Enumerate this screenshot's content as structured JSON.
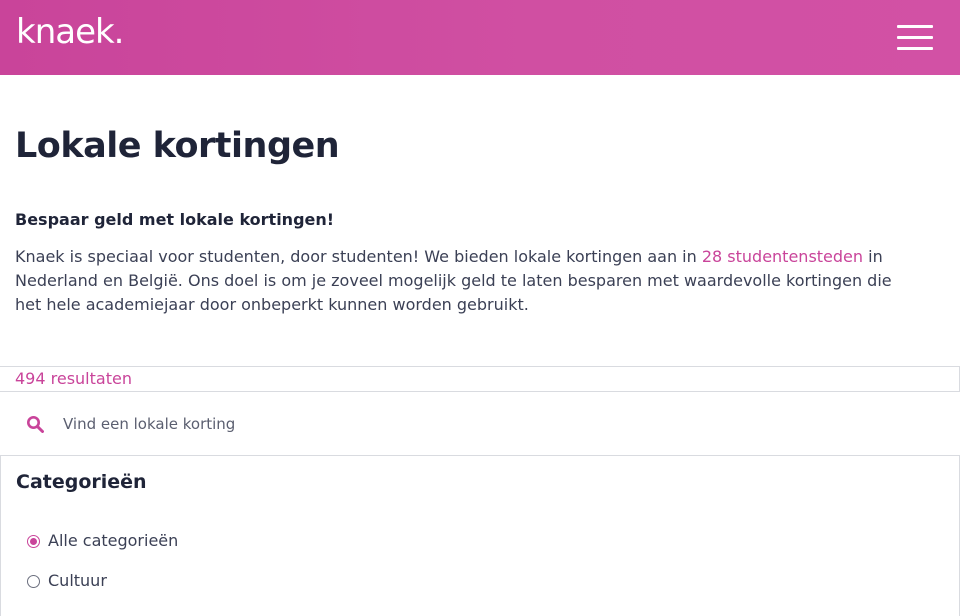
{
  "header": {
    "logo": "knaek.",
    "menu_icon": "hamburger-menu-icon"
  },
  "main": {
    "title": "Lokale kortingen",
    "subtitle": "Bespaar geld met lokale kortingen!",
    "intro_before_link": "Knaek is speciaal voor studenten, door studenten! We bieden lokale kortingen aan in ",
    "intro_link": "28 studentensteden",
    "intro_after_link": " in Nederland en België. Ons doel is om je zoveel mogelijk geld te laten besparen met waardevolle kortingen die het hele academiejaar door onbeperkt kunnen worden gebruikt."
  },
  "results": {
    "count_label": "494 resultaten"
  },
  "search": {
    "icon": "search-icon",
    "placeholder": "Vind een lokale korting",
    "value": ""
  },
  "categories": {
    "title": "Categorieën",
    "options": [
      {
        "label": "Alle categorieën",
        "selected": true
      },
      {
        "label": "Cultuur",
        "selected": false
      }
    ]
  },
  "colors": {
    "brand": "#c9449a",
    "text_dark": "#1f2438",
    "text_body": "#3b4055",
    "border": "#d9dbe0"
  }
}
